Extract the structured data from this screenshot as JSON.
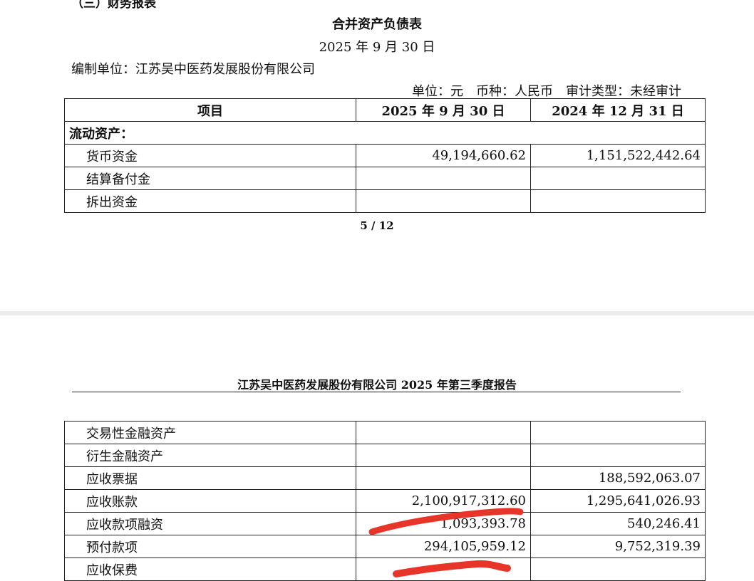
{
  "page1": {
    "cut_title": "（三）财务报表",
    "title": "合并资产负债表",
    "date": "2025 年 9 月 30 日",
    "unit": "编制单位：江苏吴中医药发展股份有限公司",
    "meta": "单位：元　币种：人民币　审计类型：未经审计",
    "table": {
      "headers": [
        "项目",
        "2025 年 9 月 30 日",
        "2024 年 12 月 31 日"
      ],
      "section": "流动资产：",
      "rows": [
        {
          "item": "货币资金",
          "v1": "49,194,660.62",
          "v2": "1,151,522,442.64"
        },
        {
          "item": "结算备付金",
          "v1": "",
          "v2": ""
        },
        {
          "item": "拆出资金",
          "v1": "",
          "v2": ""
        }
      ]
    },
    "page_number": "5 / 12"
  },
  "page2": {
    "header": "江苏吴中医药发展股份有限公司  2025 年第三季度报告",
    "rows": [
      {
        "item": "交易性金融资产",
        "v1": "",
        "v2": ""
      },
      {
        "item": "衍生金融资产",
        "v1": "",
        "v2": ""
      },
      {
        "item": "应收票据",
        "v1": "",
        "v2": "188,592,063.07"
      },
      {
        "item": "应收账款",
        "v1": "2,100,917,312.60",
        "v2": "1,295,641,026.93"
      },
      {
        "item": "应收款项融资",
        "v1": "1,093,393.78",
        "v2": "540,246.41"
      },
      {
        "item": "预付款项",
        "v1": "294,105,959.12",
        "v2": "9,752,319.39"
      },
      {
        "item": "应收保费",
        "v1": "",
        "v2": ""
      }
    ]
  },
  "colors": {
    "redaction": "#e8352a",
    "text": "#111111",
    "divider": "#ececec"
  }
}
